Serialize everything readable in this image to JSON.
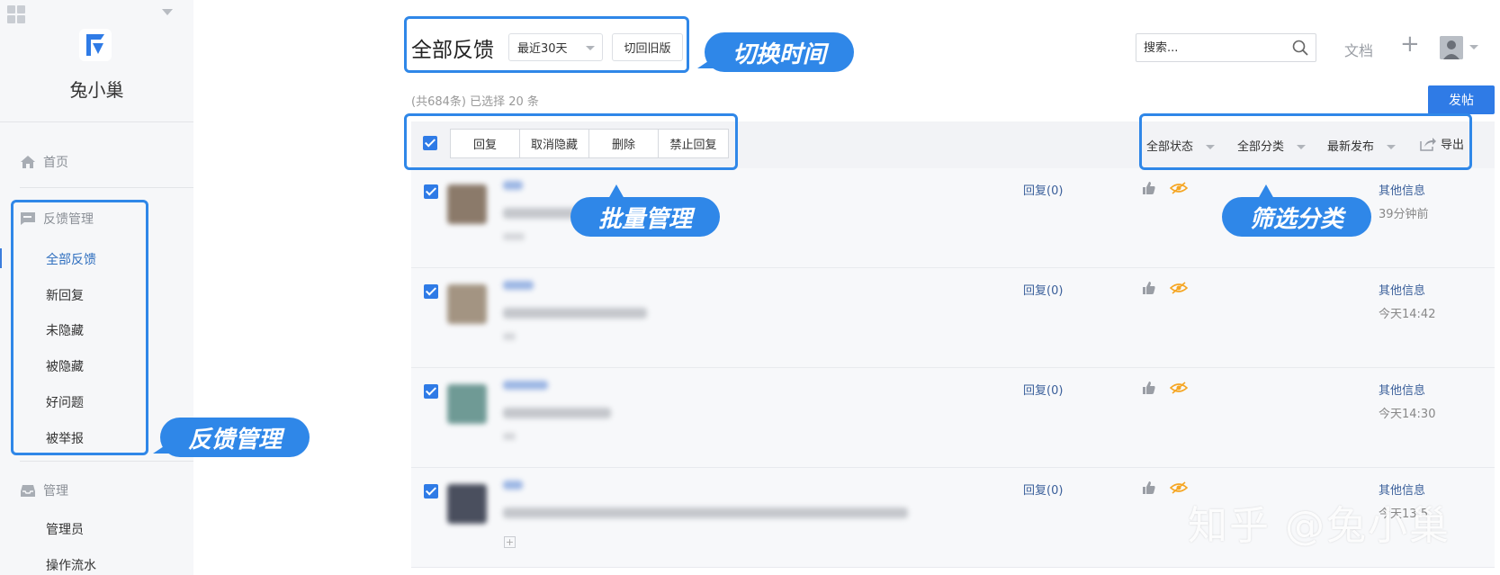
{
  "sidebar": {
    "brand": "兔小巢",
    "home": "首页",
    "feedback_group": "反馈管理",
    "feedback_items": [
      {
        "label": "全部反馈",
        "active": true
      },
      {
        "label": "新回复"
      },
      {
        "label": "未隐藏"
      },
      {
        "label": "被隐藏"
      },
      {
        "label": "好问题"
      },
      {
        "label": "被举报"
      }
    ],
    "manage_group": "管理",
    "manage_items": [
      "管理员",
      "操作流水"
    ]
  },
  "header": {
    "title": "全部反馈",
    "range_select": "最近30天",
    "old_version_button": "切回旧版",
    "search_placeholder": "搜索...",
    "docs_link": "文档",
    "add_button": "+"
  },
  "summary": {
    "count_text": "(共684条) 已选择 20 条",
    "post_button": "发帖"
  },
  "toolbar": {
    "buttons": [
      "回复",
      "取消隐藏",
      "删除",
      "禁止回复"
    ],
    "filters": [
      "全部状态",
      "全部分类",
      "最新发布"
    ],
    "export": "导出"
  },
  "rows": [
    {
      "reply": "回复(0)",
      "other": "其他信息",
      "time": "39分钟前"
    },
    {
      "reply": "回复(0)",
      "other": "其他信息",
      "time": "今天14:42"
    },
    {
      "reply": "回复(0)",
      "other": "其他信息",
      "time": "今天14:30"
    },
    {
      "reply": "回复(0)",
      "other": "其他信息",
      "time": "今天13:5"
    }
  ],
  "callouts": {
    "switch_time": "切换时间",
    "batch_manage": "批量管理",
    "filter_category": "筛选分类",
    "feedback_manage": "反馈管理"
  },
  "watermark": "知乎 @兔小巢",
  "colors": {
    "accent": "#2f7be6",
    "callout": "#2f87e8",
    "link": "#3a5f9a",
    "eye_icon": "#f5a623"
  }
}
